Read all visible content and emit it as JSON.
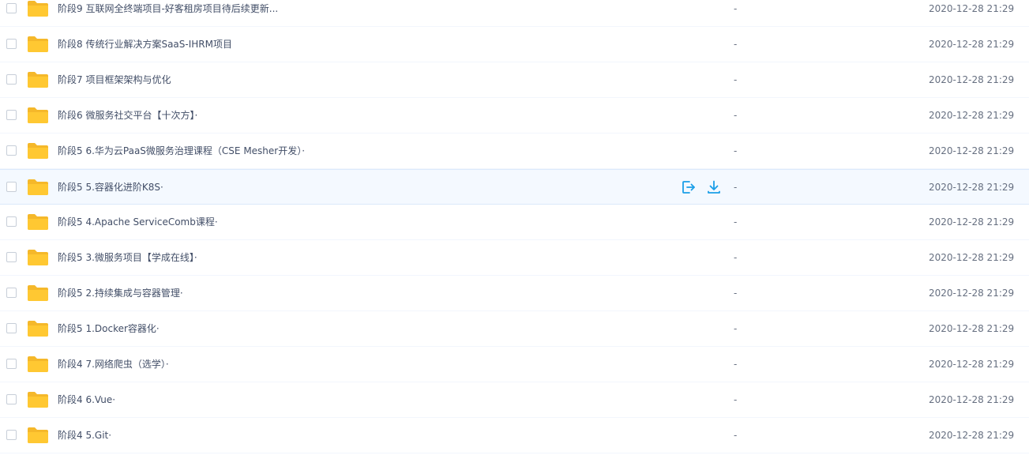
{
  "colors": {
    "folder": "#ffc832",
    "folder_back": "#f5b82a",
    "action_icon": "#1a9ee8",
    "hover_bg": "#f4f9ff"
  },
  "files": [
    {
      "name": "阶段9 互联网全终端项目-好客租房项目待后续更新...",
      "size": "-",
      "date": "2020-12-28 21:29"
    },
    {
      "name": "阶段8 传统行业解决方案SaaS-IHRM项目",
      "size": "-",
      "date": "2020-12-28 21:29"
    },
    {
      "name": "阶段7 项目框架架构与优化",
      "size": "-",
      "date": "2020-12-28 21:29"
    },
    {
      "name": "阶段6 微服务社交平台【十次方】·",
      "size": "-",
      "date": "2020-12-28 21:29"
    },
    {
      "name": "阶段5 6.华为云PaaS微服务治理课程（CSE Mesher开发）·",
      "size": "-",
      "date": "2020-12-28 21:29"
    },
    {
      "name": "阶段5 5.容器化进阶K8S·",
      "size": "-",
      "date": "2020-12-28 21:29",
      "hovered": true
    },
    {
      "name": "阶段5 4.Apache ServiceComb课程·",
      "size": "-",
      "date": "2020-12-28 21:29"
    },
    {
      "name": "阶段5 3.微服务项目【学成在线】·",
      "size": "-",
      "date": "2020-12-28 21:29"
    },
    {
      "name": "阶段5 2.持续集成与容器管理·",
      "size": "-",
      "date": "2020-12-28 21:29"
    },
    {
      "name": "阶段5 1.Docker容器化·",
      "size": "-",
      "date": "2020-12-28 21:29"
    },
    {
      "name": "阶段4 7.网络爬虫（选学）·",
      "size": "-",
      "date": "2020-12-28 21:29"
    },
    {
      "name": "阶段4 6.Vue·",
      "size": "-",
      "date": "2020-12-28 21:29"
    },
    {
      "name": "阶段4 5.Git·",
      "size": "-",
      "date": "2020-12-28 21:29"
    }
  ],
  "row_actions": {
    "share_icon": "share-icon",
    "download_icon": "download-icon"
  }
}
